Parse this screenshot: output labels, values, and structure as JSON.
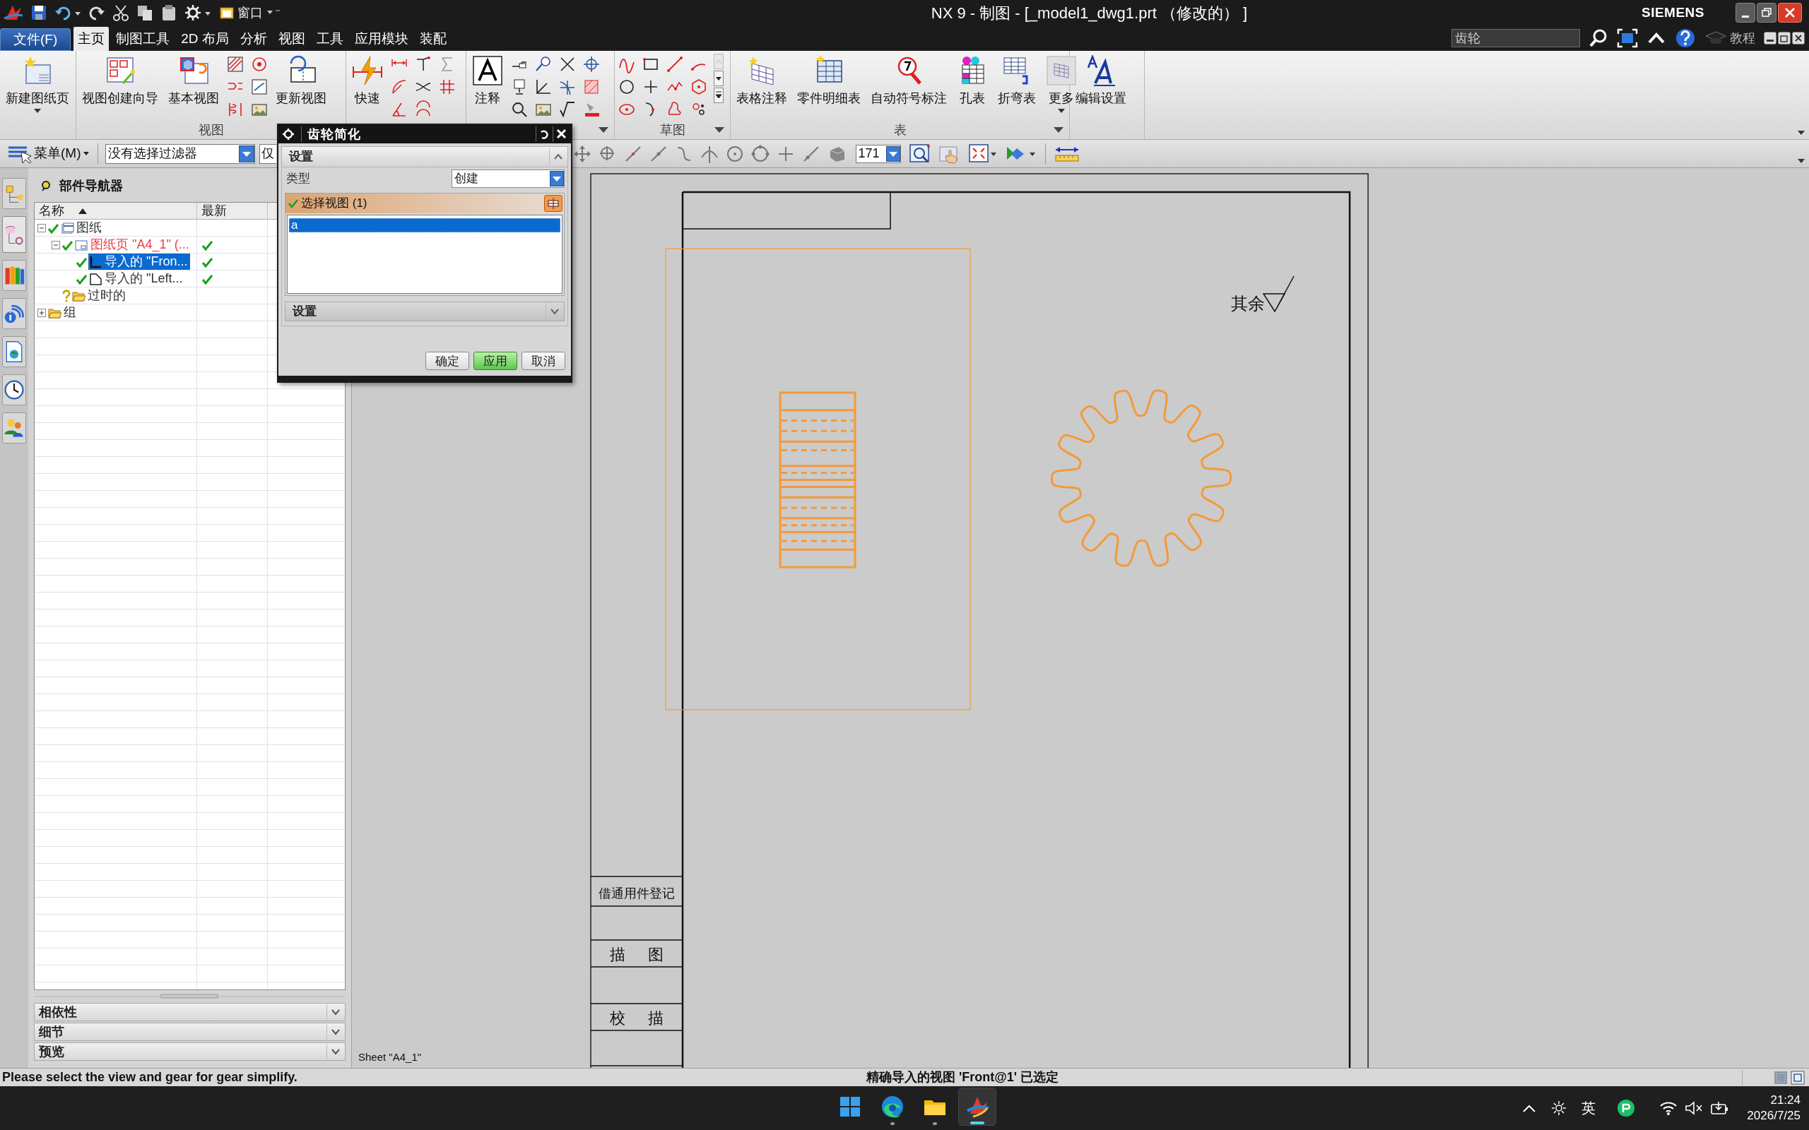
{
  "window": {
    "title": "NX 9 - 制图 - [_model1_dwg1.prt （修改的） ]",
    "brand": "SIEMENS"
  },
  "quick_access": {
    "window_button": "窗口"
  },
  "tabs": [
    {
      "label": "文件(F)",
      "kind": "file",
      "selected": false
    },
    {
      "label": "主页",
      "kind": "tab",
      "selected": true
    },
    {
      "label": "制图工具",
      "kind": "tab",
      "selected": false
    },
    {
      "label": "2D 布局",
      "kind": "tab",
      "selected": false
    },
    {
      "label": "分析",
      "kind": "tab",
      "selected": false
    },
    {
      "label": "视图",
      "kind": "tab",
      "selected": false
    },
    {
      "label": "工具",
      "kind": "tab",
      "selected": false
    },
    {
      "label": "应用模块",
      "kind": "tab",
      "selected": false
    },
    {
      "label": "装配",
      "kind": "tab",
      "selected": false
    }
  ],
  "command_search": {
    "value": "齿轮"
  },
  "help_link": "教程",
  "ribbon": [
    {
      "more": false,
      "items": [
        {
          "kind": "large",
          "label": "新建图纸页",
          "dropdown": true
        }
      ]
    },
    {
      "label": "视图",
      "items": [
        {
          "kind": "large",
          "label": "视图创建向导",
          "dropdown": false
        },
        {
          "kind": "large",
          "label": "基本视图",
          "dropdown": false
        },
        {
          "kind": "small_grid"
        },
        {
          "kind": "large",
          "label": "更新视图",
          "dropdown": false
        }
      ]
    },
    {
      "items": [
        {
          "kind": "large",
          "label": "快速",
          "dropdown": false
        },
        {
          "kind": "small_grid"
        }
      ]
    },
    {
      "more": true,
      "items": [
        {
          "kind": "large",
          "label": "注释",
          "dropdown": false
        },
        {
          "kind": "small_grid"
        }
      ]
    },
    {
      "label": "草图",
      "more": true,
      "items": [
        {
          "kind": "small_grid"
        }
      ]
    },
    {
      "label": "表",
      "more": true,
      "items": [
        {
          "kind": "large",
          "label": "表格注释",
          "dropdown": false
        },
        {
          "kind": "large",
          "label": "零件明细表",
          "dropdown": false
        },
        {
          "kind": "large",
          "label": "自动符号标注",
          "dropdown": false
        },
        {
          "kind": "large",
          "label": "孔表",
          "dropdown": false
        },
        {
          "kind": "large",
          "label": "折弯表",
          "dropdown": false
        },
        {
          "kind": "large",
          "label": "更多",
          "dropdown": true
        }
      ]
    },
    {
      "more": false,
      "items": [
        {
          "kind": "large",
          "label": "编辑设置",
          "dropdown": false
        }
      ]
    }
  ],
  "selection_bar": {
    "menu_button": "菜单(M)",
    "filter": "没有选择过滤器",
    "scope": "仅",
    "scale": "171"
  },
  "navigator": {
    "title": "部件导航器",
    "columns": [
      "名称",
      "最新"
    ],
    "tree": [
      {
        "label": "图纸",
        "kind": "drawing",
        "checked": true,
        "unknown": false,
        "latest": false,
        "expanded": true,
        "selected": false,
        "current": false,
        "children": [
          {
            "label": "图纸页 \"A4_1\" (...",
            "kind": "sheet",
            "checked": true,
            "unknown": false,
            "latest": true,
            "expanded": true,
            "selected": false,
            "current": true,
            "children": [
              {
                "label": "导入的 \"Fron...",
                "kind": "view_front",
                "checked": true,
                "unknown": false,
                "latest": true,
                "selected": true,
                "current": false
              },
              {
                "label": "导入的 \"Left...",
                "kind": "view_side",
                "checked": true,
                "unknown": false,
                "latest": true,
                "selected": false,
                "current": false
              }
            ]
          },
          {
            "label": "过时的",
            "kind": "folder",
            "checked": false,
            "unknown": true,
            "latest": false,
            "selected": false,
            "current": false
          }
        ]
      },
      {
        "label": "组",
        "kind": "folder",
        "checked": false,
        "unknown": false,
        "latest": false,
        "expanded": false,
        "selected": false,
        "current": false
      }
    ],
    "panels": [
      {
        "label": "相依性",
        "expanded": false
      },
      {
        "label": "细节",
        "expanded": false
      },
      {
        "label": "预览",
        "expanded": false
      }
    ]
  },
  "dialog": {
    "title": "齿轮简化",
    "top_section": {
      "label": "设置",
      "expanded": true
    },
    "type_label": "类型",
    "type_value": "创建",
    "select": {
      "label": "选择视图 (1)",
      "done": true
    },
    "list": [
      {
        "label": "a",
        "selected": true
      }
    ],
    "bottom_section": {
      "label": "设置",
      "expanded": false
    },
    "buttons": [
      {
        "label": "确定",
        "default": false
      },
      {
        "label": "应用",
        "default": true
      },
      {
        "label": "取消",
        "default": false
      }
    ]
  },
  "canvas": {
    "sheet_label": "Sheet \"A4_1\"",
    "surface_note": "其余",
    "title_block": [
      "借通用件登记",
      "描 图",
      "校 描"
    ]
  },
  "status_bar": {
    "prompt": "Please select the view and gear for gear simplify.",
    "message": "精确导入的视图 'Front@1' 已选定"
  },
  "resource_tabs": [
    {
      "selected": false
    },
    {
      "selected": true
    },
    {
      "selected": false
    },
    {
      "selected": false
    },
    {
      "selected": false
    },
    {
      "selected": false
    },
    {
      "selected": false
    }
  ],
  "taskbar": {
    "apps": [
      {
        "kind": "start",
        "running": false,
        "active": false
      },
      {
        "kind": "edge",
        "running": true,
        "active": false
      },
      {
        "kind": "explorer",
        "running": true,
        "active": false
      },
      {
        "kind": "nx",
        "running": true,
        "active": true
      }
    ],
    "ime": "英",
    "time": "21:24",
    "date": "2026/7/25"
  }
}
